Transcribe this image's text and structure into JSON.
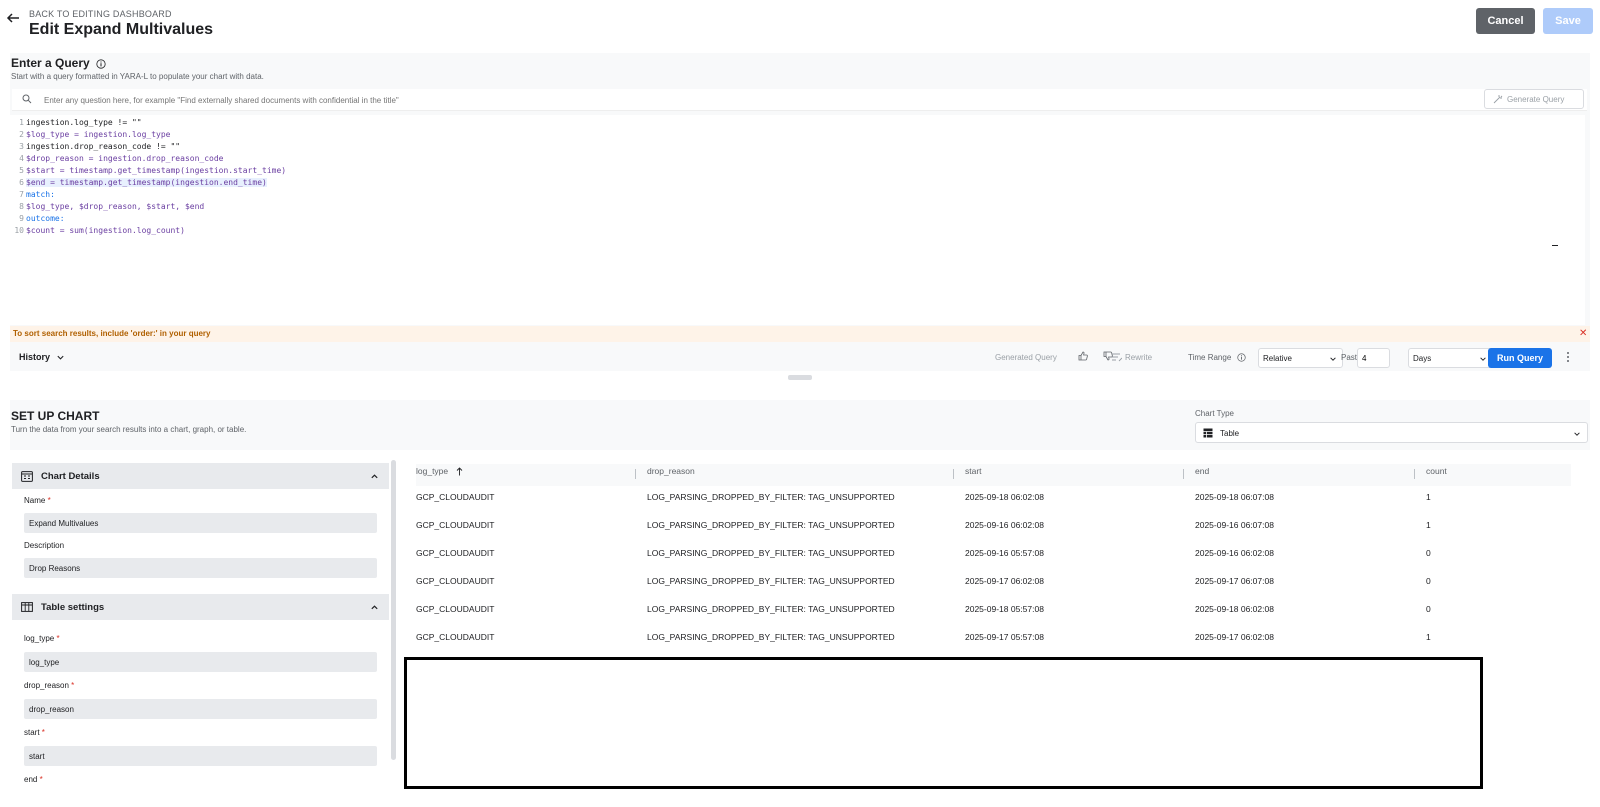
{
  "header": {
    "back_link": "BACK TO EDITING DASHBOARD",
    "title": "Edit Expand Multivalues",
    "cancel_label": "Cancel",
    "save_label": "Save"
  },
  "query": {
    "title": "Enter a Query",
    "subtitle": "Start with a query formatted in YARA-L to populate your chart with data.",
    "search_placeholder": "Enter any question here, for example \"Find externally shared documents with confidential in the title\"",
    "generate_label": "Generate Query",
    "code_lines": [
      "ingestion.log_type != \"\"",
      "$log_type = ingestion.log_type",
      "ingestion.drop_reason_code != \"\"",
      "$drop_reason = ingestion.drop_reason_code",
      "$start = timestamp.get_timestamp(ingestion.start_time)",
      "$end = timestamp.get_timestamp(ingestion.end_time)",
      "match:",
      "$log_type, $drop_reason, $start, $end",
      "outcome:",
      "$count = sum(ingestion.log_count)"
    ],
    "line_numbers": [
      "1",
      "2",
      "3",
      "4",
      "5",
      "6",
      "7",
      "8",
      "9",
      "10"
    ],
    "warning": "To sort search results, include 'order:' in your query",
    "history_label": "History",
    "generated_query_label": "Generated Query",
    "rewrite_label": "Rewrite",
    "time_range_label": "Time Range",
    "time_range_value": "Relative",
    "past_label": "Past",
    "past_value": "4",
    "unit_value": "Days",
    "run_label": "Run Query"
  },
  "setup": {
    "title": "SET UP CHART",
    "subtitle": "Turn the data from your search results into a chart, graph, or table.",
    "chart_type_label": "Chart Type",
    "chart_type_value": "Table"
  },
  "chart_details": {
    "title": "Chart Details",
    "name_label": "Name",
    "name_value": "Expand Multivalues",
    "description_label": "Description",
    "description_value": "Drop Reasons"
  },
  "table_settings": {
    "title": "Table settings",
    "fields": [
      {
        "label": "log_type",
        "value": "log_type"
      },
      {
        "label": "drop_reason",
        "value": "drop_reason"
      },
      {
        "label": "start",
        "value": "start"
      },
      {
        "label": "end",
        "value": ""
      }
    ]
  },
  "results": {
    "columns": [
      "log_type",
      "drop_reason",
      "start",
      "end",
      "count"
    ],
    "rows": [
      [
        "GCP_CLOUDAUDIT",
        "LOG_PARSING_DROPPED_BY_FILTER: TAG_UNSUPPORTED",
        "2025-09-18 06:02:08",
        "2025-09-18 06:07:08",
        "1"
      ],
      [
        "GCP_CLOUDAUDIT",
        "LOG_PARSING_DROPPED_BY_FILTER: TAG_UNSUPPORTED",
        "2025-09-16 06:02:08",
        "2025-09-16 06:07:08",
        "1"
      ],
      [
        "GCP_CLOUDAUDIT",
        "LOG_PARSING_DROPPED_BY_FILTER: TAG_UNSUPPORTED",
        "2025-09-16 05:57:08",
        "2025-09-16 06:02:08",
        "0"
      ],
      [
        "GCP_CLOUDAUDIT",
        "LOG_PARSING_DROPPED_BY_FILTER: TAG_UNSUPPORTED",
        "2025-09-17 06:02:08",
        "2025-09-17 06:07:08",
        "0"
      ],
      [
        "GCP_CLOUDAUDIT",
        "LOG_PARSING_DROPPED_BY_FILTER: TAG_UNSUPPORTED",
        "2025-09-18 05:57:08",
        "2025-09-18 06:02:08",
        "0"
      ],
      [
        "GCP_CLOUDAUDIT",
        "LOG_PARSING_DROPPED_BY_FILTER: TAG_UNSUPPORTED",
        "2025-09-17 05:57:08",
        "2025-09-17 06:02:08",
        "1"
      ]
    ]
  },
  "colors": {
    "primary": "#1a73e8",
    "cancel": "#5f6368",
    "save_disabled": "#aecbfa",
    "warning_text": "#b06000",
    "warning_bg": "#fef3e8"
  }
}
